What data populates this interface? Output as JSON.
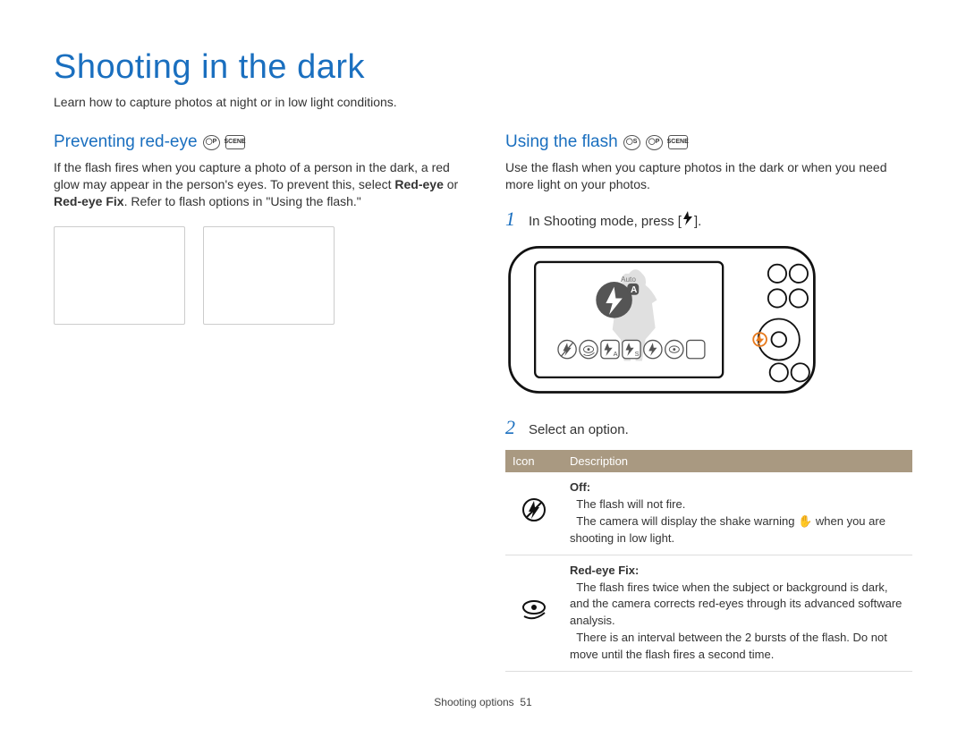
{
  "page": {
    "title": "Shooting in the dark",
    "subtitle": "Learn how to capture photos at night or in low light conditions."
  },
  "left": {
    "heading": "Preventing red-eye",
    "text_a": "If the flash fires when you capture a photo of a person in the dark, a red glow may appear in the person's eyes. To prevent this, select ",
    "bold_1": "Red-eye",
    "text_b": " or ",
    "bold_2": "Red-eye Fix",
    "text_c": ". Refer to flash options in \"Using the flash.\""
  },
  "right": {
    "heading": "Using the flash",
    "intro": "Use the flash when you capture photos in the dark or when you need more light on your photos.",
    "step1": "In Shooting mode, press [",
    "step1_end": "].",
    "step2": "Select an option.",
    "camera_label": "Auto",
    "table": {
      "h_icon": "Icon",
      "h_desc": "Description",
      "rows": [
        {
          "title": "Off",
          "line1": "The flash will not fire.",
          "line2a": "The camera will display the shake warning ",
          "line2b": " when you are shooting in low light."
        },
        {
          "title": "Red-eye Fix",
          "line1": "The flash fires twice when the subject or background is dark, and the camera corrects red-eyes through its advanced software analysis.",
          "line2": "There is an interval between the 2 bursts of the flash. Do not move until the flash fires a second time."
        }
      ]
    }
  },
  "footer": {
    "section": "Shooting options",
    "page_no": "51"
  }
}
